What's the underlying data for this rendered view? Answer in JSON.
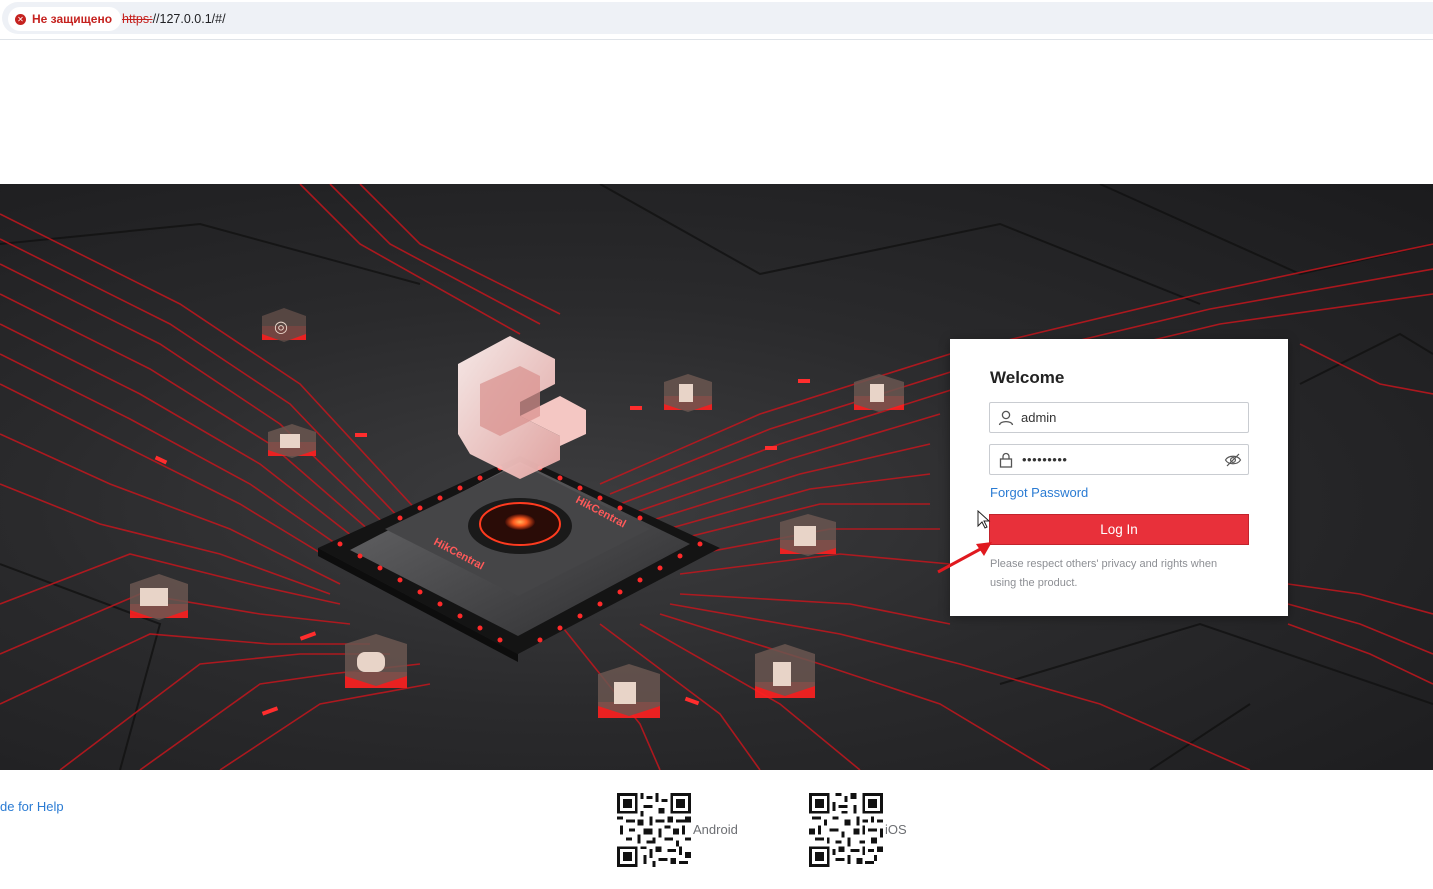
{
  "browser": {
    "security_label": "Не защищено",
    "url_scheme": "https:",
    "url_rest": "//127.0.0.1/#/"
  },
  "hero": {
    "chip_brand_text": "HikCentral"
  },
  "login": {
    "title": "Welcome",
    "username_value": "admin",
    "password_mask": "•••••••••",
    "forgot_label": "Forgot Password",
    "login_button_label": "Log In",
    "notice": "Please respect others' privacy and rights when using the product."
  },
  "footer": {
    "help_link_text": "de for Help",
    "android_label": "Android",
    "ios_label": "iOS"
  },
  "colors": {
    "accent_red": "#e8303a",
    "link_blue": "#2a7bd3",
    "insecure_red": "#c5221f"
  }
}
